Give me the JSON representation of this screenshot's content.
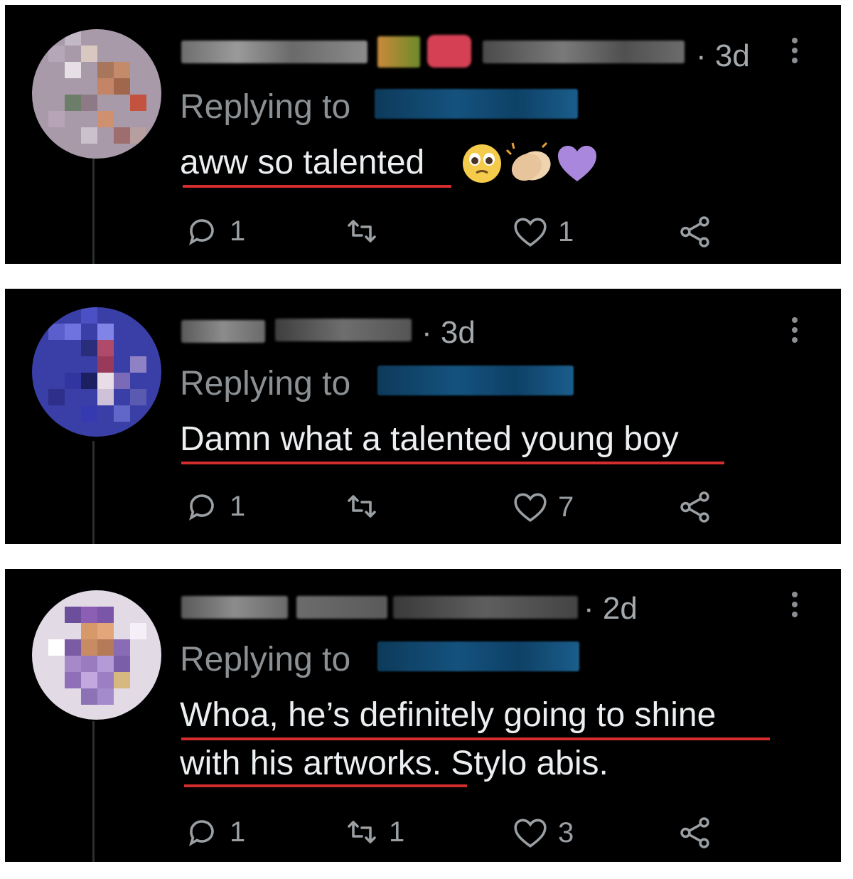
{
  "colors": {
    "background": "#000000",
    "text": "#eceff1",
    "muted": "#8b9094",
    "underline": "#d42d2d",
    "thread_line": "#2b2f33"
  },
  "replies": [
    {
      "timestamp": "· 3d",
      "replying_label": "Replying to",
      "text": "aww so talented",
      "emojis": [
        "pleading-face-emoji",
        "clapping-hands-emoji",
        "purple-heart-emoji"
      ],
      "reply_count": "1",
      "retweet_count": "",
      "like_count": "1"
    },
    {
      "timestamp": "· 3d",
      "replying_label": "Replying to",
      "text": "Damn what a talented young boy",
      "emojis": [],
      "reply_count": "1",
      "retweet_count": "",
      "like_count": "7"
    },
    {
      "timestamp": "· 2d",
      "replying_label": "Replying to",
      "text_line1": "Whoa, he’s definitely going to shine",
      "text_line2": "with his artworks. Stylo abis.",
      "emojis": [],
      "reply_count": "1",
      "retweet_count": "1",
      "like_count": "3"
    }
  ],
  "icons": [
    "reply-icon",
    "retweet-icon",
    "like-icon",
    "share-icon",
    "more-options-icon"
  ]
}
